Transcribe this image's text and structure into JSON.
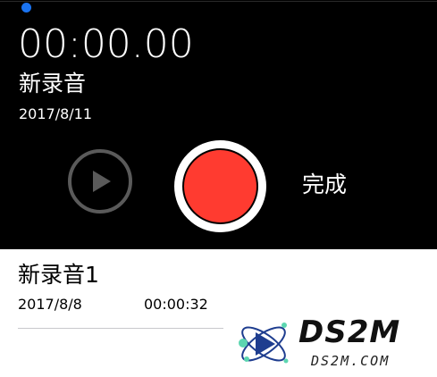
{
  "recorder": {
    "timer": "00:00.00",
    "title": "新录音",
    "date": "2017/8/11",
    "done_label": "完成"
  },
  "recordings": [
    {
      "title": "新录音1",
      "date": "2017/8/8",
      "duration": "00:00:32"
    }
  ],
  "watermark": {
    "title": "DS2M",
    "subtitle": "DS2M.COM"
  },
  "icons": {
    "play": "play-icon",
    "record": "record-icon",
    "playhead": "playhead-dot"
  },
  "colors": {
    "background_top": "#000000",
    "record_red": "#ff3b30",
    "playhead_blue": "#1a73f0",
    "play_ring": "#5a5a5a"
  }
}
